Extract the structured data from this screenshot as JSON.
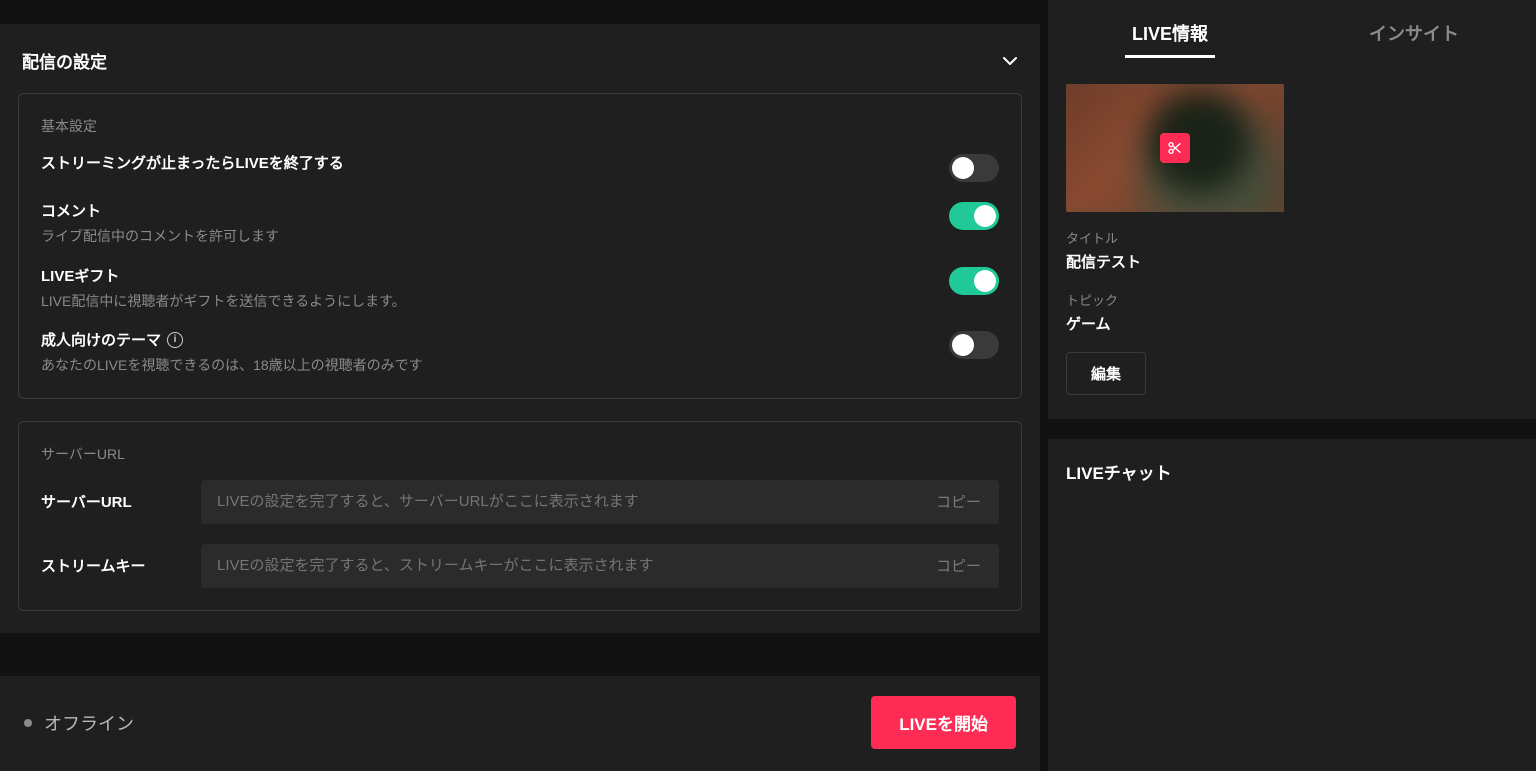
{
  "panel": {
    "title": "配信の設定",
    "basic_label": "基本設定",
    "row1": {
      "title": "ストリーミングが止まったらLIVEを終了する"
    },
    "row2": {
      "title": "コメント",
      "desc": "ライブ配信中のコメントを許可します"
    },
    "row3": {
      "title": "LIVEギフト",
      "desc": "LIVE配信中に視聴者がギフトを送信できるようにします。"
    },
    "row4": {
      "title": "成人向けのテーマ",
      "desc": "あなたのLIVEを視聴できるのは、18歳以上の視聴者のみです"
    },
    "toggles": {
      "end_on_stop": false,
      "comments": true,
      "gifts": true,
      "adult": false
    }
  },
  "server": {
    "label": "サーバーURL",
    "url_label": "サーバーURL",
    "url_placeholder": "LIVEの設定を完了すると、サーバーURLがここに表示されます",
    "key_label": "ストリームキー",
    "key_placeholder": "LIVEの設定を完了すると、ストリームキーがここに表示されます",
    "copy": "コピー"
  },
  "footer": {
    "status": "オフライン",
    "start": "LIVEを開始"
  },
  "tabs": {
    "info": "LIVE情報",
    "insight": "インサイト"
  },
  "info": {
    "title_label": "タイトル",
    "title_value": "配信テスト",
    "topic_label": "トピック",
    "topic_value": "ゲーム",
    "edit": "編集"
  },
  "chat": {
    "title": "LIVEチャット"
  }
}
